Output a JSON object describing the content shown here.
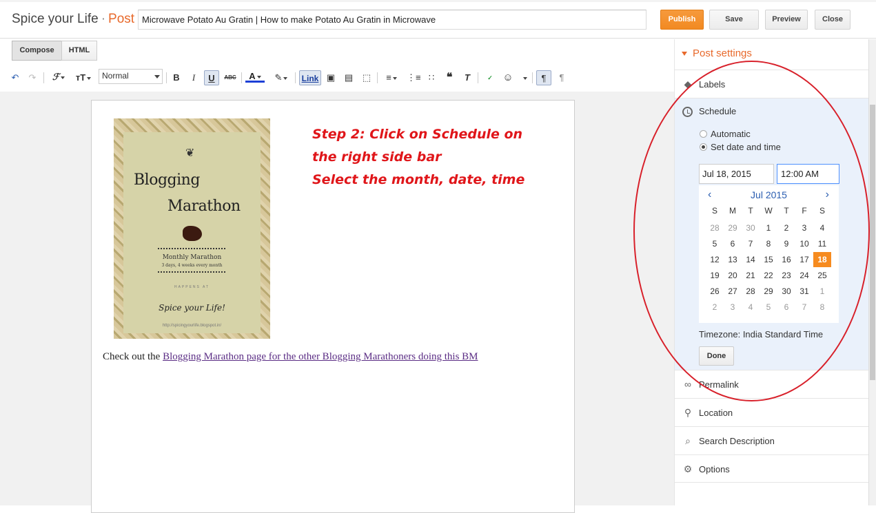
{
  "header": {
    "blog_name": "Spice your Life",
    "separator": "·",
    "section": "Post",
    "post_title": "Microwave Potato Au Gratin | How to make Potato Au Gratin in Microwave",
    "publish_label": "Publish",
    "save_label": "Save",
    "preview_label": "Preview",
    "close_label": "Close"
  },
  "modes": {
    "compose": "Compose",
    "html": "HTML"
  },
  "toolbar": {
    "font_size_value": "Normal",
    "link_label": "Link"
  },
  "content": {
    "poster": {
      "line1": "Blogging",
      "line2": "Marathon",
      "monthly": "Monthly Marathon",
      "sub": "3 days, 4 weeks every month",
      "happens": "HAPPENS AT",
      "spice": "Spice your Life!",
      "url": "http://spicingyourlife.blogspot.in/"
    },
    "annotation_line1": "Step 2: Click on Schedule on the right side bar",
    "annotation_line2": "Select the month, date, time",
    "checkout_prefix": "Check out the ",
    "checkout_link": "Blogging Marathon page for the other Blogging Marathoners doing this BM"
  },
  "sidebar": {
    "heading": "Post settings",
    "labels": "Labels",
    "schedule": "Schedule",
    "automatic": "Automatic",
    "set_date": "Set date and time",
    "date_value": "Jul 18, 2015",
    "time_value": "12:00 AM",
    "calendar": {
      "month": "Jul 2015",
      "prev": "‹",
      "next": "›",
      "dow": [
        "S",
        "M",
        "T",
        "W",
        "T",
        "F",
        "S"
      ],
      "weeks": [
        [
          "28",
          "29",
          "30",
          "1",
          "2",
          "3",
          "4"
        ],
        [
          "5",
          "6",
          "7",
          "8",
          "9",
          "10",
          "11"
        ],
        [
          "12",
          "13",
          "14",
          "15",
          "16",
          "17",
          "18"
        ],
        [
          "19",
          "20",
          "21",
          "22",
          "23",
          "24",
          "25"
        ],
        [
          "26",
          "27",
          "28",
          "29",
          "30",
          "31",
          "1"
        ],
        [
          "2",
          "3",
          "4",
          "5",
          "6",
          "7",
          "8"
        ]
      ],
      "selected": "18"
    },
    "timezone": "Timezone: India Standard Time",
    "done": "Done",
    "permalink": "Permalink",
    "location": "Location",
    "search_description": "Search Description",
    "options": "Options"
  },
  "colors": {
    "accent_orange": "#f68b1f",
    "annotation_red": "#e0161a",
    "link_blue": "#2a5db0"
  }
}
